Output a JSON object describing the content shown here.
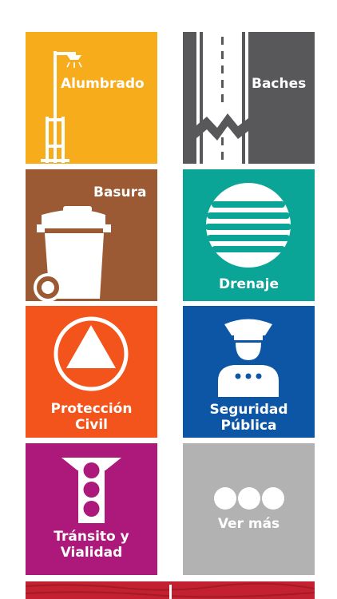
{
  "tiles": {
    "alumbrado": {
      "label": "Alumbrado",
      "color": "#f7ac1c",
      "icon": "streetlight-icon"
    },
    "baches": {
      "label": "Baches",
      "color": "#58585a",
      "icon": "road-pothole-icon"
    },
    "basura": {
      "label": "Basura",
      "color": "#9b5a33",
      "icon": "trash-bin-icon"
    },
    "drenaje": {
      "label": "Drenaje",
      "color": "#0aa596",
      "icon": "drain-grate-icon"
    },
    "proteccion_civil": {
      "label_line1": "Protección",
      "label_line2": "Civil",
      "color": "#f2541b",
      "icon": "civil-protection-triangle-icon"
    },
    "seguridad_publica": {
      "label_line1": "Seguridad",
      "label_line2": "Pública",
      "color": "#0c56a5",
      "icon": "police-officer-icon"
    },
    "transito_vialidad": {
      "label_line1": "Tránsito y",
      "label_line2": "Vialidad",
      "color": "#ad197b",
      "icon": "traffic-light-icon"
    },
    "ver_mas": {
      "label": "Ver más",
      "color": "#b2b2b2",
      "icon": "more-dots-icon"
    }
  },
  "banner": {
    "color": "#c3212f"
  }
}
